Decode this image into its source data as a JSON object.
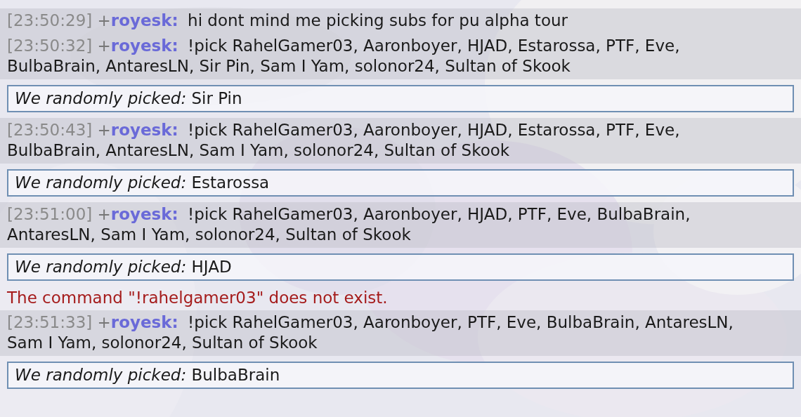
{
  "messages": [
    {
      "kind": "chat",
      "time": "[23:50:29]",
      "rank": "+",
      "user": "royesk:",
      "lines": [
        "hi dont mind me picking subs for pu alpha tour"
      ]
    },
    {
      "kind": "chat",
      "time": "[23:50:32]",
      "rank": "+",
      "user": "royesk:",
      "lines": [
        "!pick RahelGamer03, Aaronboyer, HJAD, Estarossa, PTF, Eve,",
        "BulbaBrain, AntaresLN, Sir Pin, Sam I Yam, solonor24, Sultan of Skook"
      ]
    },
    {
      "kind": "picked",
      "label": "We randomly picked:",
      "value": "Sir Pin"
    },
    {
      "kind": "chat",
      "time": "[23:50:43]",
      "rank": "+",
      "user": "royesk:",
      "lines": [
        "!pick RahelGamer03, Aaronboyer, HJAD, Estarossa, PTF, Eve,",
        "BulbaBrain, AntaresLN, Sam I Yam, solonor24, Sultan of Skook"
      ]
    },
    {
      "kind": "picked",
      "label": "We randomly picked:",
      "value": "Estarossa"
    },
    {
      "kind": "chat",
      "time": "[23:51:00]",
      "rank": "+",
      "user": "royesk:",
      "lines": [
        "!pick RahelGamer03, Aaronboyer, HJAD, PTF, Eve, BulbaBrain,",
        "AntaresLN, Sam I Yam, solonor24, Sultan of Skook"
      ]
    },
    {
      "kind": "picked",
      "label": "We randomly picked:",
      "value": "HJAD"
    },
    {
      "kind": "error",
      "text": "The command \"!rahelgamer03\" does not exist."
    },
    {
      "kind": "chat",
      "time": "[23:51:33]",
      "rank": "+",
      "user": "royesk:",
      "lines": [
        "!pick RahelGamer03, Aaronboyer, PTF, Eve, BulbaBrain, AntaresLN,",
        "Sam I Yam, solonor24, Sultan of Skook"
      ]
    },
    {
      "kind": "picked",
      "label": "We randomly picked:",
      "value": "BulbaBrain"
    }
  ]
}
